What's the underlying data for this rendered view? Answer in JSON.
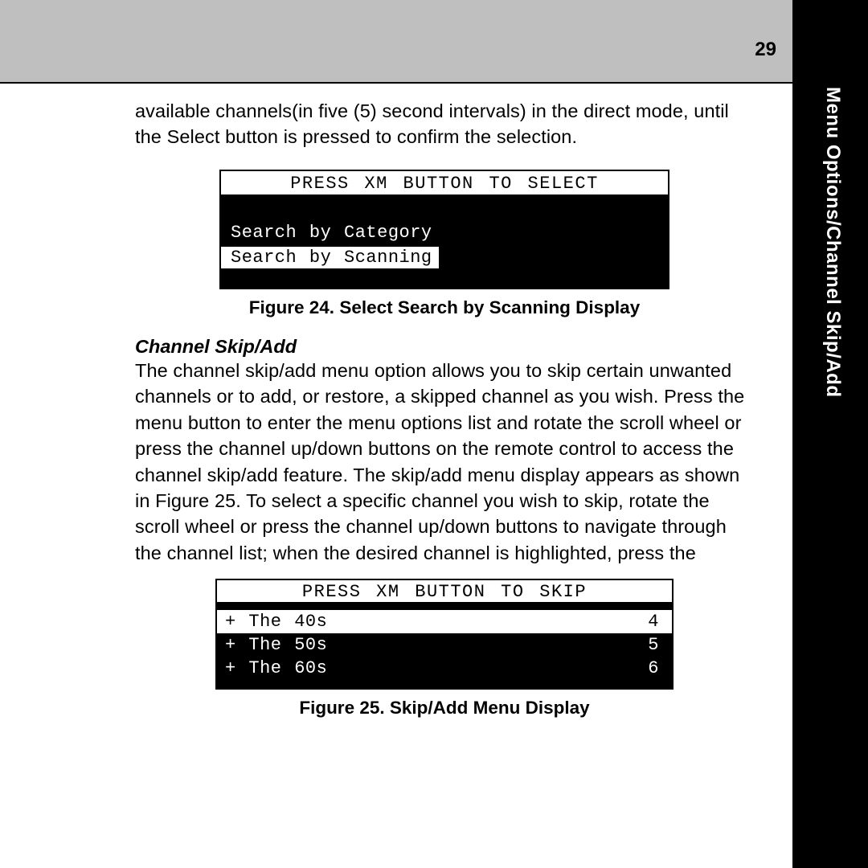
{
  "page_number": "29",
  "side_tab": "Menu Options/Channel Skip/Add",
  "intro_paragraph": "available channels(in five (5) second intervals) in the direct mode, until the Select button is pressed to confirm the selection.",
  "figure24": {
    "header": "PRESS XM BUTTON TO SELECT",
    "line1": "Search by Category",
    "line2": "Search by Scanning",
    "caption": "Figure 24. Select Search by Scanning Display"
  },
  "subhead": "Channel Skip/Add",
  "body_paragraph": "The channel skip/add menu option allows you to skip certain unwanted channels or to add, or restore, a skipped channel as you wish. Press the menu button to enter the menu options list and rotate the scroll wheel or press the channel up/down buttons on the remote control to access the channel skip/add feature. The skip/add menu display appears as shown in Figure 25. To select a specific channel you wish to skip, rotate the scroll wheel or press the channel up/down buttons to navigate through the channel list; when the desired channel is highlighted, press the",
  "figure25": {
    "header": "PRESS XM BUTTON TO SKIP",
    "rows": [
      {
        "label": "+ The 40s",
        "num": "4",
        "highlighted": true
      },
      {
        "label": "+ The 50s",
        "num": "5",
        "highlighted": false
      },
      {
        "label": "+ The 60s",
        "num": "6",
        "highlighted": false
      }
    ],
    "caption": "Figure 25. Skip/Add Menu Display"
  }
}
